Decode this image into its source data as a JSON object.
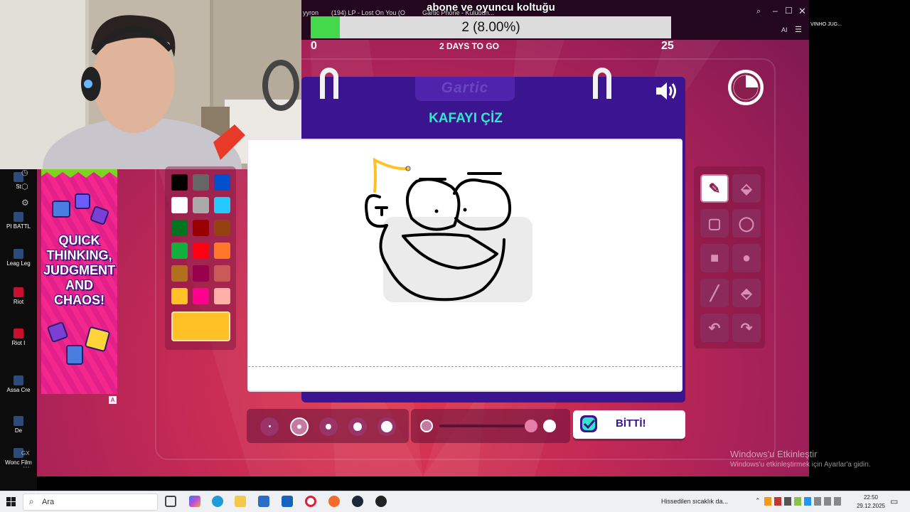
{
  "overlay": {
    "title": "abone ve oyuncu koltuğu"
  },
  "goal": {
    "progress_text": "2 (8.00%)",
    "progress_fraction": 0.08,
    "start": "0",
    "end": "25",
    "days_left": "2 DAYS TO GO"
  },
  "browser": {
    "tabs": [
      "yyron",
      "(194) LP - Lost On You (O",
      "Gartic Phone - Kulübün..."
    ],
    "right_label": "AI"
  },
  "right_edge": {
    "text": "VINHO JUG..."
  },
  "desktop": {
    "icons": [
      "St",
      "PI BATTL",
      "Leag Leg",
      "Riot",
      "Riot I",
      "Assa Cre",
      "De",
      "Wonc Film"
    ],
    "gx_label": "GX"
  },
  "ad": {
    "text": "QUICK THINKING, JUDGMENT AND CHAOS!",
    "badge": "A"
  },
  "game": {
    "logo": "Gartic",
    "task": "KAFAYI ÇİZ",
    "done_label": "BİTTİ!",
    "palette": [
      "#000000",
      "#666666",
      "#0050cd",
      "#ffffff",
      "#aaaaaa",
      "#26c9ff",
      "#017420",
      "#990000",
      "#964112",
      "#11b03c",
      "#ff0013",
      "#ff7829",
      "#b0701c",
      "#99004e",
      "#cb5a57",
      "#ffc126",
      "#ff008f",
      "#feafa8"
    ],
    "current_color": "#ffc126",
    "tools": [
      "pencil-icon",
      "eraser-icon",
      "rectangle-icon",
      "ellipse-icon",
      "filled-rectangle-icon",
      "filled-ellipse-icon",
      "line-icon",
      "bucket-icon",
      "undo-icon",
      "redo-icon"
    ]
  },
  "windows": {
    "activate_title": "Windows'u Etkinleştir",
    "activate_sub": "Windows'u etkinleştirmek için Ayarlar'a gidin."
  },
  "taskbar": {
    "search_placeholder": "Ara",
    "weather": "Hissedilen sıcaklık da...",
    "time": "22:50",
    "date": "29.12.2025"
  }
}
